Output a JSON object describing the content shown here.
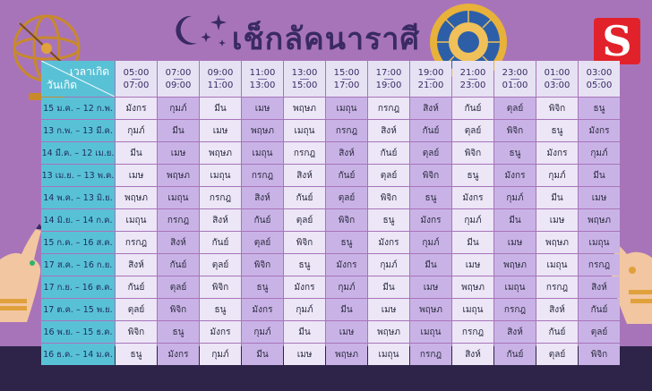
{
  "title": "เช็กลัคนาราศี",
  "logo": {
    "letter": "S",
    "color": "#e2222b"
  },
  "colors": {
    "background": "#a874b9",
    "date_column": "#59c1d6",
    "cell_light": "#ece6f7",
    "cell_dark": "#c9b3e6",
    "title": "#3a2a63"
  },
  "decorations": [
    "armillary-sphere-icon",
    "moon-icon",
    "sparkle-stars-icon",
    "zodiac-wheel-icon",
    "left-hand-icon",
    "right-hand-icon"
  ],
  "table": {
    "corner_time_label": "เวลาเกิด",
    "corner_day_label": "วันเกิด",
    "times": [
      {
        "start": "05:00",
        "end": "07:00"
      },
      {
        "start": "07:00",
        "end": "09:00"
      },
      {
        "start": "09:00",
        "end": "11:00"
      },
      {
        "start": "11:00",
        "end": "13:00"
      },
      {
        "start": "13:00",
        "end": "15:00"
      },
      {
        "start": "15:00",
        "end": "17:00"
      },
      {
        "start": "17:00",
        "end": "19:00"
      },
      {
        "start": "19:00",
        "end": "21:00"
      },
      {
        "start": "21:00",
        "end": "23:00"
      },
      {
        "start": "23:00",
        "end": "01:00"
      },
      {
        "start": "01:00",
        "end": "03:00"
      },
      {
        "start": "03:00",
        "end": "05:00"
      }
    ],
    "rows": [
      {
        "date": "15 ม.ค. – 12 ก.พ.",
        "signs": [
          "มังกร",
          "กุมภ์",
          "มีน",
          "เมษ",
          "พฤษภ",
          "เมถุน",
          "กรกฎ",
          "สิงห์",
          "กันย์",
          "ตุลย์",
          "พิจิก",
          "ธนู"
        ]
      },
      {
        "date": "13 ก.พ. – 13 มี.ค.",
        "signs": [
          "กุมภ์",
          "มีน",
          "เมษ",
          "พฤษภ",
          "เมถุน",
          "กรกฎ",
          "สิงห์",
          "กันย์",
          "ตุลย์",
          "พิจิก",
          "ธนู",
          "มังกร"
        ]
      },
      {
        "date": "14 มี.ค. – 12 เม.ย.",
        "signs": [
          "มีน",
          "เมษ",
          "พฤษภ",
          "เมถุน",
          "กรกฎ",
          "สิงห์",
          "กันย์",
          "ตุลย์",
          "พิจิก",
          "ธนู",
          "มังกร",
          "กุมภ์"
        ]
      },
      {
        "date": "13 เม.ย. – 13 พ.ค.",
        "signs": [
          "เมษ",
          "พฤษภ",
          "เมถุน",
          "กรกฎ",
          "สิงห์",
          "กันย์",
          "ตุลย์",
          "พิจิก",
          "ธนู",
          "มังกร",
          "กุมภ์",
          "มีน"
        ]
      },
      {
        "date": "14 พ.ค. – 13 มิ.ย.",
        "signs": [
          "พฤษภ",
          "เมถุน",
          "กรกฎ",
          "สิงห์",
          "กันย์",
          "ตุลย์",
          "พิจิก",
          "ธนู",
          "มังกร",
          "กุมภ์",
          "มีน",
          "เมษ"
        ]
      },
      {
        "date": "14 มิ.ย. – 14 ก.ค.",
        "signs": [
          "เมถุน",
          "กรกฎ",
          "สิงห์",
          "กันย์",
          "ตุลย์",
          "พิจิก",
          "ธนู",
          "มังกร",
          "กุมภ์",
          "มีน",
          "เมษ",
          "พฤษภ"
        ]
      },
      {
        "date": "15 ก.ค. – 16 ส.ค.",
        "signs": [
          "กรกฎ",
          "สิงห์",
          "กันย์",
          "ตุลย์",
          "พิจิก",
          "ธนู",
          "มังกร",
          "กุมภ์",
          "มีน",
          "เมษ",
          "พฤษภ",
          "เมถุน"
        ]
      },
      {
        "date": "17 ส.ค. – 16 ก.ย.",
        "signs": [
          "สิงห์",
          "กันย์",
          "ตุลย์",
          "พิจิก",
          "ธนู",
          "มังกร",
          "กุมภ์",
          "มีน",
          "เมษ",
          "พฤษภ",
          "เมถุน",
          "กรกฎ"
        ]
      },
      {
        "date": "17 ก.ย. – 16 ต.ค.",
        "signs": [
          "กันย์",
          "ตุลย์",
          "พิจิก",
          "ธนู",
          "มังกร",
          "กุมภ์",
          "มีน",
          "เมษ",
          "พฤษภ",
          "เมถุน",
          "กรกฎ",
          "สิงห์"
        ]
      },
      {
        "date": "17 ต.ค. – 15 พ.ย.",
        "signs": [
          "ตุลย์",
          "พิจิก",
          "ธนู",
          "มังกร",
          "กุมภ์",
          "มีน",
          "เมษ",
          "พฤษภ",
          "เมถุน",
          "กรกฎ",
          "สิงห์",
          "กันย์"
        ]
      },
      {
        "date": "16 พ.ย. – 15 ธ.ค.",
        "signs": [
          "พิจิก",
          "ธนู",
          "มังกร",
          "กุมภ์",
          "มีน",
          "เมษ",
          "พฤษภ",
          "เมถุน",
          "กรกฎ",
          "สิงห์",
          "กันย์",
          "ตุลย์"
        ]
      },
      {
        "date": "16 ธ.ค. – 14 ม.ค.",
        "signs": [
          "ธนู",
          "มังกร",
          "กุมภ์",
          "มีน",
          "เมษ",
          "พฤษภ",
          "เมถุน",
          "กรกฎ",
          "สิงห์",
          "กันย์",
          "ตุลย์",
          "พิจิก"
        ]
      }
    ]
  }
}
